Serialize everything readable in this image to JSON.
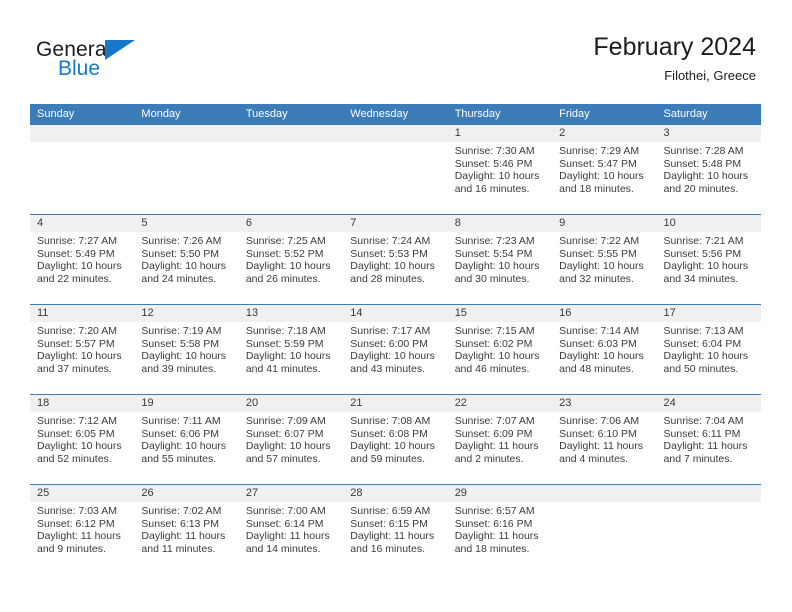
{
  "brand": {
    "name_dark": "General",
    "name_blue": "Blue",
    "triangle_color": "#1878c8"
  },
  "header": {
    "title": "February 2024",
    "subtitle": "Filothei, Greece"
  },
  "colors": {
    "header_blue": "#3c7cb8",
    "daynum_band": "#f0f0f0",
    "text": "#3b3b3b"
  },
  "calendar": {
    "weekday_headers": [
      "Sunday",
      "Monday",
      "Tuesday",
      "Wednesday",
      "Thursday",
      "Friday",
      "Saturday"
    ],
    "weeks": [
      [
        {
          "day": "",
          "sunrise": "",
          "sunset": "",
          "daylight_a": "",
          "daylight_b": ""
        },
        {
          "day": "",
          "sunrise": "",
          "sunset": "",
          "daylight_a": "",
          "daylight_b": ""
        },
        {
          "day": "",
          "sunrise": "",
          "sunset": "",
          "daylight_a": "",
          "daylight_b": ""
        },
        {
          "day": "",
          "sunrise": "",
          "sunset": "",
          "daylight_a": "",
          "daylight_b": ""
        },
        {
          "day": "1",
          "sunrise": "Sunrise: 7:30 AM",
          "sunset": "Sunset: 5:46 PM",
          "daylight_a": "Daylight: 10 hours",
          "daylight_b": "and 16 minutes."
        },
        {
          "day": "2",
          "sunrise": "Sunrise: 7:29 AM",
          "sunset": "Sunset: 5:47 PM",
          "daylight_a": "Daylight: 10 hours",
          "daylight_b": "and 18 minutes."
        },
        {
          "day": "3",
          "sunrise": "Sunrise: 7:28 AM",
          "sunset": "Sunset: 5:48 PM",
          "daylight_a": "Daylight: 10 hours",
          "daylight_b": "and 20 minutes."
        }
      ],
      [
        {
          "day": "4",
          "sunrise": "Sunrise: 7:27 AM",
          "sunset": "Sunset: 5:49 PM",
          "daylight_a": "Daylight: 10 hours",
          "daylight_b": "and 22 minutes."
        },
        {
          "day": "5",
          "sunrise": "Sunrise: 7:26 AM",
          "sunset": "Sunset: 5:50 PM",
          "daylight_a": "Daylight: 10 hours",
          "daylight_b": "and 24 minutes."
        },
        {
          "day": "6",
          "sunrise": "Sunrise: 7:25 AM",
          "sunset": "Sunset: 5:52 PM",
          "daylight_a": "Daylight: 10 hours",
          "daylight_b": "and 26 minutes."
        },
        {
          "day": "7",
          "sunrise": "Sunrise: 7:24 AM",
          "sunset": "Sunset: 5:53 PM",
          "daylight_a": "Daylight: 10 hours",
          "daylight_b": "and 28 minutes."
        },
        {
          "day": "8",
          "sunrise": "Sunrise: 7:23 AM",
          "sunset": "Sunset: 5:54 PM",
          "daylight_a": "Daylight: 10 hours",
          "daylight_b": "and 30 minutes."
        },
        {
          "day": "9",
          "sunrise": "Sunrise: 7:22 AM",
          "sunset": "Sunset: 5:55 PM",
          "daylight_a": "Daylight: 10 hours",
          "daylight_b": "and 32 minutes."
        },
        {
          "day": "10",
          "sunrise": "Sunrise: 7:21 AM",
          "sunset": "Sunset: 5:56 PM",
          "daylight_a": "Daylight: 10 hours",
          "daylight_b": "and 34 minutes."
        }
      ],
      [
        {
          "day": "11",
          "sunrise": "Sunrise: 7:20 AM",
          "sunset": "Sunset: 5:57 PM",
          "daylight_a": "Daylight: 10 hours",
          "daylight_b": "and 37 minutes."
        },
        {
          "day": "12",
          "sunrise": "Sunrise: 7:19 AM",
          "sunset": "Sunset: 5:58 PM",
          "daylight_a": "Daylight: 10 hours",
          "daylight_b": "and 39 minutes."
        },
        {
          "day": "13",
          "sunrise": "Sunrise: 7:18 AM",
          "sunset": "Sunset: 5:59 PM",
          "daylight_a": "Daylight: 10 hours",
          "daylight_b": "and 41 minutes."
        },
        {
          "day": "14",
          "sunrise": "Sunrise: 7:17 AM",
          "sunset": "Sunset: 6:00 PM",
          "daylight_a": "Daylight: 10 hours",
          "daylight_b": "and 43 minutes."
        },
        {
          "day": "15",
          "sunrise": "Sunrise: 7:15 AM",
          "sunset": "Sunset: 6:02 PM",
          "daylight_a": "Daylight: 10 hours",
          "daylight_b": "and 46 minutes."
        },
        {
          "day": "16",
          "sunrise": "Sunrise: 7:14 AM",
          "sunset": "Sunset: 6:03 PM",
          "daylight_a": "Daylight: 10 hours",
          "daylight_b": "and 48 minutes."
        },
        {
          "day": "17",
          "sunrise": "Sunrise: 7:13 AM",
          "sunset": "Sunset: 6:04 PM",
          "daylight_a": "Daylight: 10 hours",
          "daylight_b": "and 50 minutes."
        }
      ],
      [
        {
          "day": "18",
          "sunrise": "Sunrise: 7:12 AM",
          "sunset": "Sunset: 6:05 PM",
          "daylight_a": "Daylight: 10 hours",
          "daylight_b": "and 52 minutes."
        },
        {
          "day": "19",
          "sunrise": "Sunrise: 7:11 AM",
          "sunset": "Sunset: 6:06 PM",
          "daylight_a": "Daylight: 10 hours",
          "daylight_b": "and 55 minutes."
        },
        {
          "day": "20",
          "sunrise": "Sunrise: 7:09 AM",
          "sunset": "Sunset: 6:07 PM",
          "daylight_a": "Daylight: 10 hours",
          "daylight_b": "and 57 minutes."
        },
        {
          "day": "21",
          "sunrise": "Sunrise: 7:08 AM",
          "sunset": "Sunset: 6:08 PM",
          "daylight_a": "Daylight: 10 hours",
          "daylight_b": "and 59 minutes."
        },
        {
          "day": "22",
          "sunrise": "Sunrise: 7:07 AM",
          "sunset": "Sunset: 6:09 PM",
          "daylight_a": "Daylight: 11 hours",
          "daylight_b": "and 2 minutes."
        },
        {
          "day": "23",
          "sunrise": "Sunrise: 7:06 AM",
          "sunset": "Sunset: 6:10 PM",
          "daylight_a": "Daylight: 11 hours",
          "daylight_b": "and 4 minutes."
        },
        {
          "day": "24",
          "sunrise": "Sunrise: 7:04 AM",
          "sunset": "Sunset: 6:11 PM",
          "daylight_a": "Daylight: 11 hours",
          "daylight_b": "and 7 minutes."
        }
      ],
      [
        {
          "day": "25",
          "sunrise": "Sunrise: 7:03 AM",
          "sunset": "Sunset: 6:12 PM",
          "daylight_a": "Daylight: 11 hours",
          "daylight_b": "and 9 minutes."
        },
        {
          "day": "26",
          "sunrise": "Sunrise: 7:02 AM",
          "sunset": "Sunset: 6:13 PM",
          "daylight_a": "Daylight: 11 hours",
          "daylight_b": "and 11 minutes."
        },
        {
          "day": "27",
          "sunrise": "Sunrise: 7:00 AM",
          "sunset": "Sunset: 6:14 PM",
          "daylight_a": "Daylight: 11 hours",
          "daylight_b": "and 14 minutes."
        },
        {
          "day": "28",
          "sunrise": "Sunrise: 6:59 AM",
          "sunset": "Sunset: 6:15 PM",
          "daylight_a": "Daylight: 11 hours",
          "daylight_b": "and 16 minutes."
        },
        {
          "day": "29",
          "sunrise": "Sunrise: 6:57 AM",
          "sunset": "Sunset: 6:16 PM",
          "daylight_a": "Daylight: 11 hours",
          "daylight_b": "and 18 minutes."
        },
        {
          "day": "",
          "sunrise": "",
          "sunset": "",
          "daylight_a": "",
          "daylight_b": ""
        },
        {
          "day": "",
          "sunrise": "",
          "sunset": "",
          "daylight_a": "",
          "daylight_b": ""
        }
      ]
    ]
  }
}
